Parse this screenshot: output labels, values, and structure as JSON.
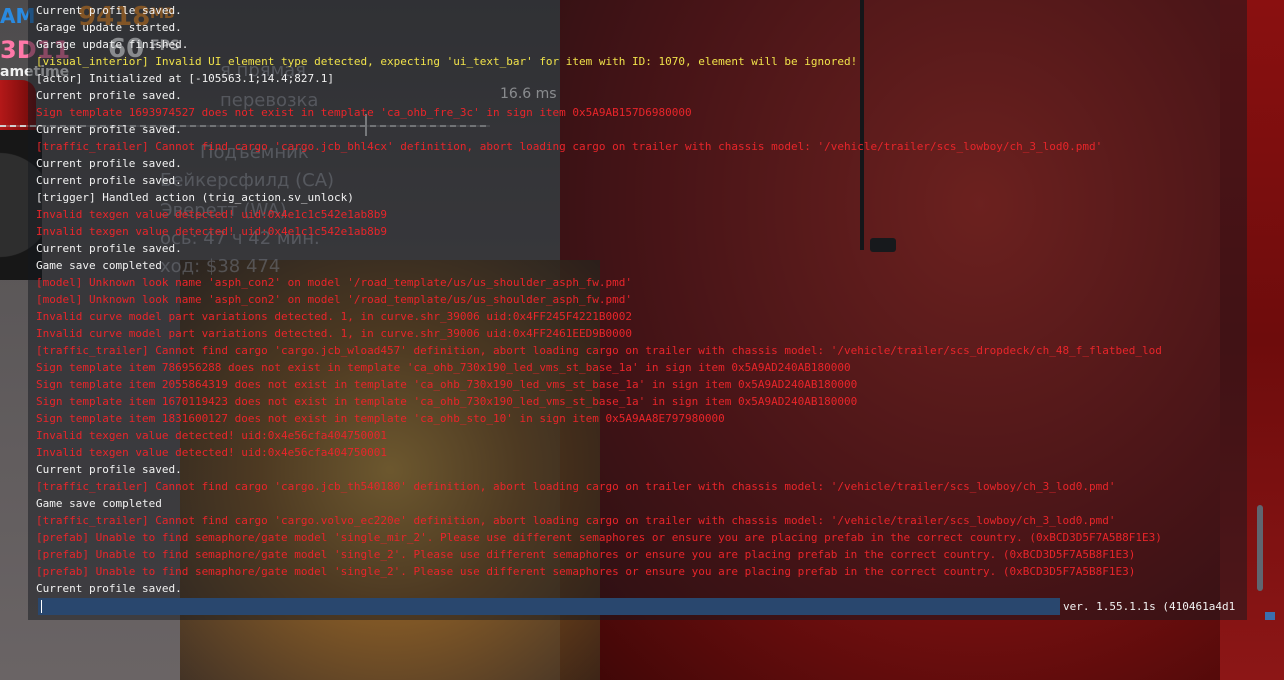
{
  "hud": {
    "ram_label": "AM",
    "mem_value": "9418",
    "mem_unit": "MB",
    "api_label": "3D11",
    "fps_value": "60",
    "fps_unit": "FPS",
    "frametime_label": "ametime",
    "frame_ms": "16.6 ms"
  },
  "route_panel": {
    "lines": [
      "я прямая",
      "перевозка",
      "Подъемник",
      "Бейкерсфилд (CA)",
      "Эверетт (WA)",
      "ось: 47 ч 42 мин.",
      "ход: $38 474"
    ]
  },
  "console": {
    "lines": [
      {
        "text": "Current profile saved.",
        "level": "ok"
      },
      {
        "text": "Garage update started.",
        "level": "ok"
      },
      {
        "text": "Garage update finished.",
        "level": "ok"
      },
      {
        "text": "[visual_interior] Invalid UI element type detected, expecting 'ui_text_bar' for item with ID: 1070, element will be ignored!",
        "level": "warn"
      },
      {
        "text": "[actor] Initialized at [-105563.1;14.4;827.1]",
        "level": "ok"
      },
      {
        "text": "Current profile saved.",
        "level": "ok"
      },
      {
        "text": "Sign template 1693974527 does not exist in template 'ca_ohb_fre_3c' in sign item 0x5A9AB157D6980000",
        "level": "err"
      },
      {
        "text": "Current profile saved.",
        "level": "ok"
      },
      {
        "text": "[traffic_trailer] Cannot find cargo 'cargo.jcb_bhl4cx' definition, abort loading cargo on trailer with chassis model: '/vehicle/trailer/scs_lowboy/ch_3_lod0.pmd'",
        "level": "err"
      },
      {
        "text": "Current profile saved.",
        "level": "ok"
      },
      {
        "text": "Current profile saved.",
        "level": "ok"
      },
      {
        "text": "[trigger] Handled action (trig_action.sv_unlock)",
        "level": "ok"
      },
      {
        "text": "Invalid texgen value detected! uid:0x4e1c1c542e1ab8b9",
        "level": "err"
      },
      {
        "text": "Invalid texgen value detected! uid:0x4e1c1c542e1ab8b9",
        "level": "err"
      },
      {
        "text": "Current profile saved.",
        "level": "ok"
      },
      {
        "text": "Game save completed",
        "level": "ok"
      },
      {
        "text": "[model] Unknown look name 'asph_con2' on model '/road_template/us/us_shoulder_asph_fw.pmd'",
        "level": "err"
      },
      {
        "text": "[model] Unknown look name 'asph_con2' on model '/road_template/us/us_shoulder_asph_fw.pmd'",
        "level": "err"
      },
      {
        "text": "Invalid curve model part variations detected. 1, in curve.shr_39006 uid:0x4FF245F4221B0002",
        "level": "err"
      },
      {
        "text": "Invalid curve model part variations detected. 1, in curve.shr_39006 uid:0x4FF2461EED9B0000",
        "level": "err"
      },
      {
        "text": "[traffic_trailer] Cannot find cargo 'cargo.jcb_wload457' definition, abort loading cargo on trailer with chassis model: '/vehicle/trailer/scs_dropdeck/ch_48_f_flatbed_lod",
        "level": "err"
      },
      {
        "text": "Sign template item 786956288 does not exist in template 'ca_ohb_730x190_led_vms_st_base_1a' in sign item 0x5A9AD240AB180000",
        "level": "err"
      },
      {
        "text": "Sign template item 2055864319 does not exist in template 'ca_ohb_730x190_led_vms_st_base_1a' in sign item 0x5A9AD240AB180000",
        "level": "err"
      },
      {
        "text": "Sign template item 1670119423 does not exist in template 'ca_ohb_730x190_led_vms_st_base_1a' in sign item 0x5A9AD240AB180000",
        "level": "err"
      },
      {
        "text": "Sign template item 1831600127 does not exist in template 'ca_ohb_sto_10' in sign item 0x5A9AA8E797980000",
        "level": "err"
      },
      {
        "text": "Invalid texgen value detected! uid:0x4e56cfa404750001",
        "level": "err"
      },
      {
        "text": "Invalid texgen value detected! uid:0x4e56cfa404750001",
        "level": "err"
      },
      {
        "text": "Current profile saved.",
        "level": "ok"
      },
      {
        "text": "[traffic_trailer] Cannot find cargo 'cargo.jcb_th540180' definition, abort loading cargo on trailer with chassis model: '/vehicle/trailer/scs_lowboy/ch_3_lod0.pmd'",
        "level": "err"
      },
      {
        "text": "Game save completed",
        "level": "ok"
      },
      {
        "text": "[traffic_trailer] Cannot find cargo 'cargo.volvo_ec220e' definition, abort loading cargo on trailer with chassis model: '/vehicle/trailer/scs_lowboy/ch_3_lod0.pmd'",
        "level": "err"
      },
      {
        "text": "[prefab] Unable to find semaphore/gate model 'single_mir_2'. Please use different semaphores or ensure you are placing prefab in the correct country. (0xBCD3D5F7A5B8F1E3)",
        "level": "err"
      },
      {
        "text": "[prefab] Unable to find semaphore/gate model 'single_2'. Please use different semaphores or ensure you are placing prefab in the correct country. (0xBCD3D5F7A5B8F1E3)",
        "level": "err"
      },
      {
        "text": "[prefab] Unable to find semaphore/gate model 'single_2'. Please use different semaphores or ensure you are placing prefab in the correct country. (0xBCD3D5F7A5B8F1E3)",
        "level": "err"
      },
      {
        "text": "Current profile saved.",
        "level": "ok"
      }
    ],
    "input_value": "",
    "version": "ver. 1.55.1.1s (410461a4d1"
  },
  "colors": {
    "ok": "#f2f2f2",
    "warn": "#f0e24a",
    "err": "#e8252a",
    "input_bar": "#29476e"
  }
}
